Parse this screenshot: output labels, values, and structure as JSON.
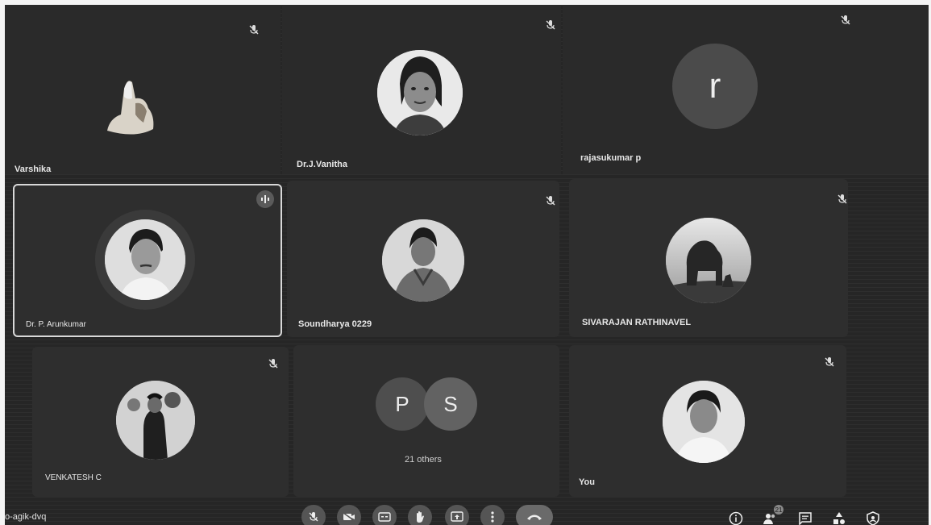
{
  "meeting": {
    "code": "o-agik-dvq"
  },
  "participants": [
    {
      "name": "Varshika"
    },
    {
      "name": "Dr.J.Vanitha"
    },
    {
      "name": "rajasukumar p",
      "initial": "r"
    },
    {
      "name": "Dr. P. Arunkumar"
    },
    {
      "name": "Soundharya 0229"
    },
    {
      "name": "SIVARAJAN RATHINAVEL"
    },
    {
      "name": "VENKATESH C"
    },
    {
      "name": "You"
    }
  ],
  "others": {
    "initials": [
      "P",
      "S"
    ],
    "label": "21 others"
  },
  "people_count": "21",
  "colors": {
    "background": "#262626",
    "tile": "#2e2e2e",
    "active_border": "#d8d8d8",
    "end_call": "#6a6a6a"
  },
  "controls": {
    "icons": [
      "mic-icon",
      "camera-icon",
      "captions-icon",
      "raise-hand-icon",
      "present-icon",
      "more-options-icon",
      "end-call-icon"
    ]
  },
  "side_icons": [
    "info-icon",
    "people-icon",
    "chat-icon",
    "activities-icon",
    "host-controls-icon"
  ]
}
